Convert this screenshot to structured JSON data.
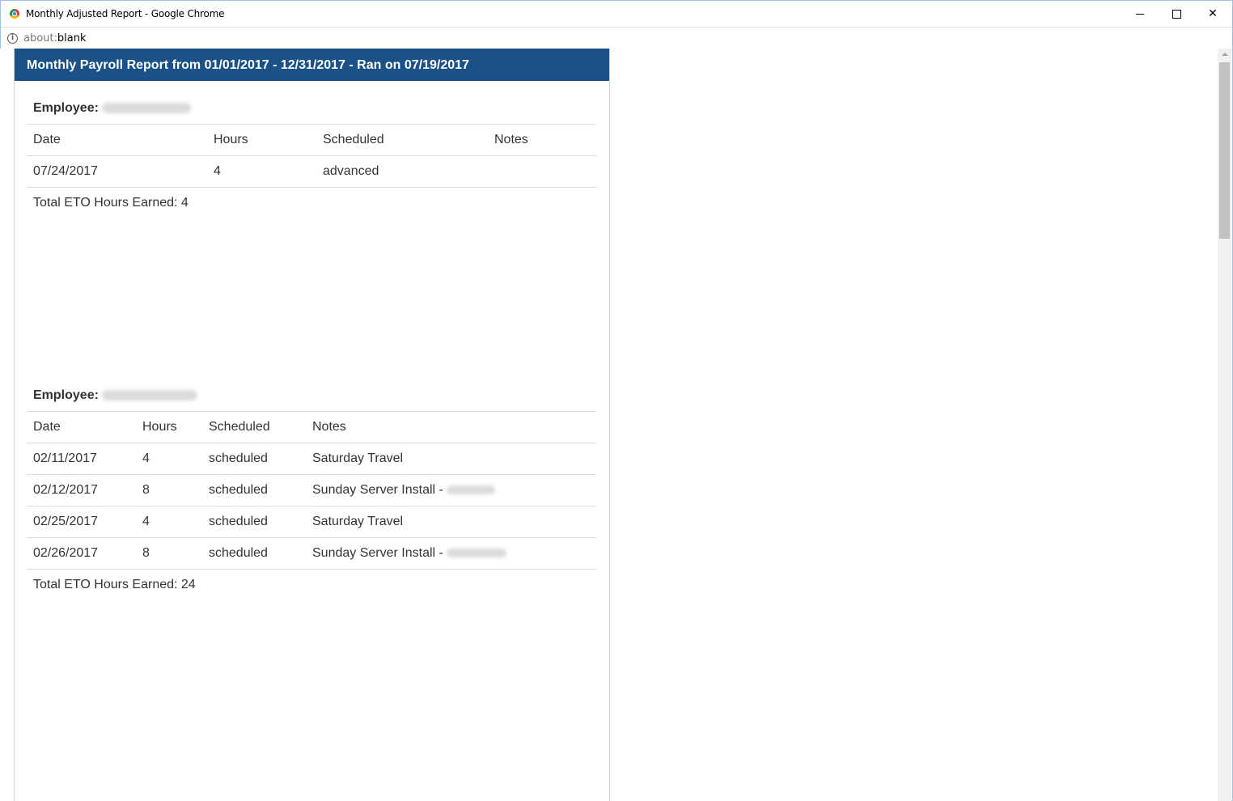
{
  "window": {
    "title": "Monthly Adjusted Report - Google Chrome",
    "minimize_glyph": "",
    "close_glyph": "✕"
  },
  "address": {
    "scheme": "about:",
    "rest": "blank",
    "info_glyph": "i"
  },
  "report": {
    "header": "Monthly Payroll Report from 01/01/2017 - 12/31/2017 - Ran on 07/19/2017",
    "employee_label": "Employee:",
    "sections": [
      {
        "columns": [
          "Date",
          "Hours",
          "Scheduled",
          "Notes"
        ],
        "rows": [
          {
            "date": "07/24/2017",
            "hours": "4",
            "scheduled": "advanced",
            "notes": ""
          }
        ],
        "total": "Total ETO Hours Earned: 4"
      },
      {
        "columns": [
          "Date",
          "Hours",
          "Scheduled",
          "Notes"
        ],
        "rows": [
          {
            "date": "02/11/2017",
            "hours": "4",
            "scheduled": "scheduled",
            "notes": "Saturday Travel"
          },
          {
            "date": "02/12/2017",
            "hours": "8",
            "scheduled": "scheduled",
            "notes": "Sunday Server Install -"
          },
          {
            "date": "02/25/2017",
            "hours": "4",
            "scheduled": "scheduled",
            "notes": "Saturday Travel"
          },
          {
            "date": "02/26/2017",
            "hours": "8",
            "scheduled": "scheduled",
            "notes": "Sunday Server Install -"
          }
        ],
        "total": "Total ETO Hours Earned: 24"
      }
    ]
  },
  "icons": {
    "app": "chrome-logo-icon",
    "info": "info-icon",
    "minimize": "minimize-icon",
    "maximize": "maximize-icon",
    "close": "close-icon"
  },
  "colors": {
    "header_bg": "#1a5186",
    "header_text": "#ffffff",
    "window_border": "#9ec3e6"
  }
}
